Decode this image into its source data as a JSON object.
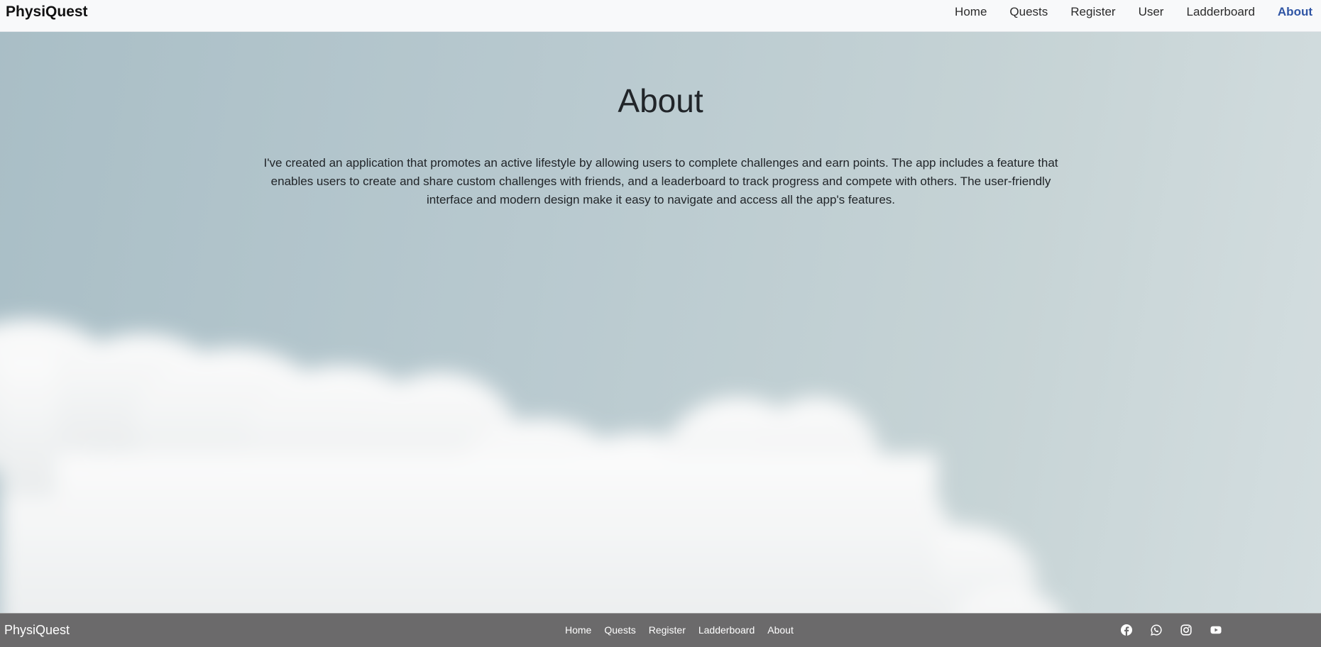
{
  "navbar": {
    "brand": "PhysiQuest",
    "links": [
      {
        "label": "Home",
        "active": false
      },
      {
        "label": "Quests",
        "active": false
      },
      {
        "label": "Register",
        "active": false
      },
      {
        "label": "User",
        "active": false
      },
      {
        "label": "Ladderboard",
        "active": false
      },
      {
        "label": "About",
        "active": true
      }
    ],
    "active_color": "#2f55a4"
  },
  "main": {
    "title": "About",
    "body": "I've created an application that promotes an active lifestyle by allowing users to complete challenges and earn points. The app includes a feature that enables users to create and share custom challenges with friends, and a leaderboard to track progress and compete with others. The user-friendly interface and modern design make it easy to navigate and access all the app's features."
  },
  "footer": {
    "brand": "PhysiQuest",
    "links": [
      {
        "label": "Home"
      },
      {
        "label": "Quests"
      },
      {
        "label": "Register"
      },
      {
        "label": "Ladderboard"
      },
      {
        "label": "About"
      }
    ],
    "social": [
      {
        "icon": "facebook-icon"
      },
      {
        "icon": "whatsapp-icon"
      },
      {
        "icon": "instagram-icon"
      },
      {
        "icon": "youtube-icon"
      }
    ],
    "background": "#6b6a6b"
  }
}
